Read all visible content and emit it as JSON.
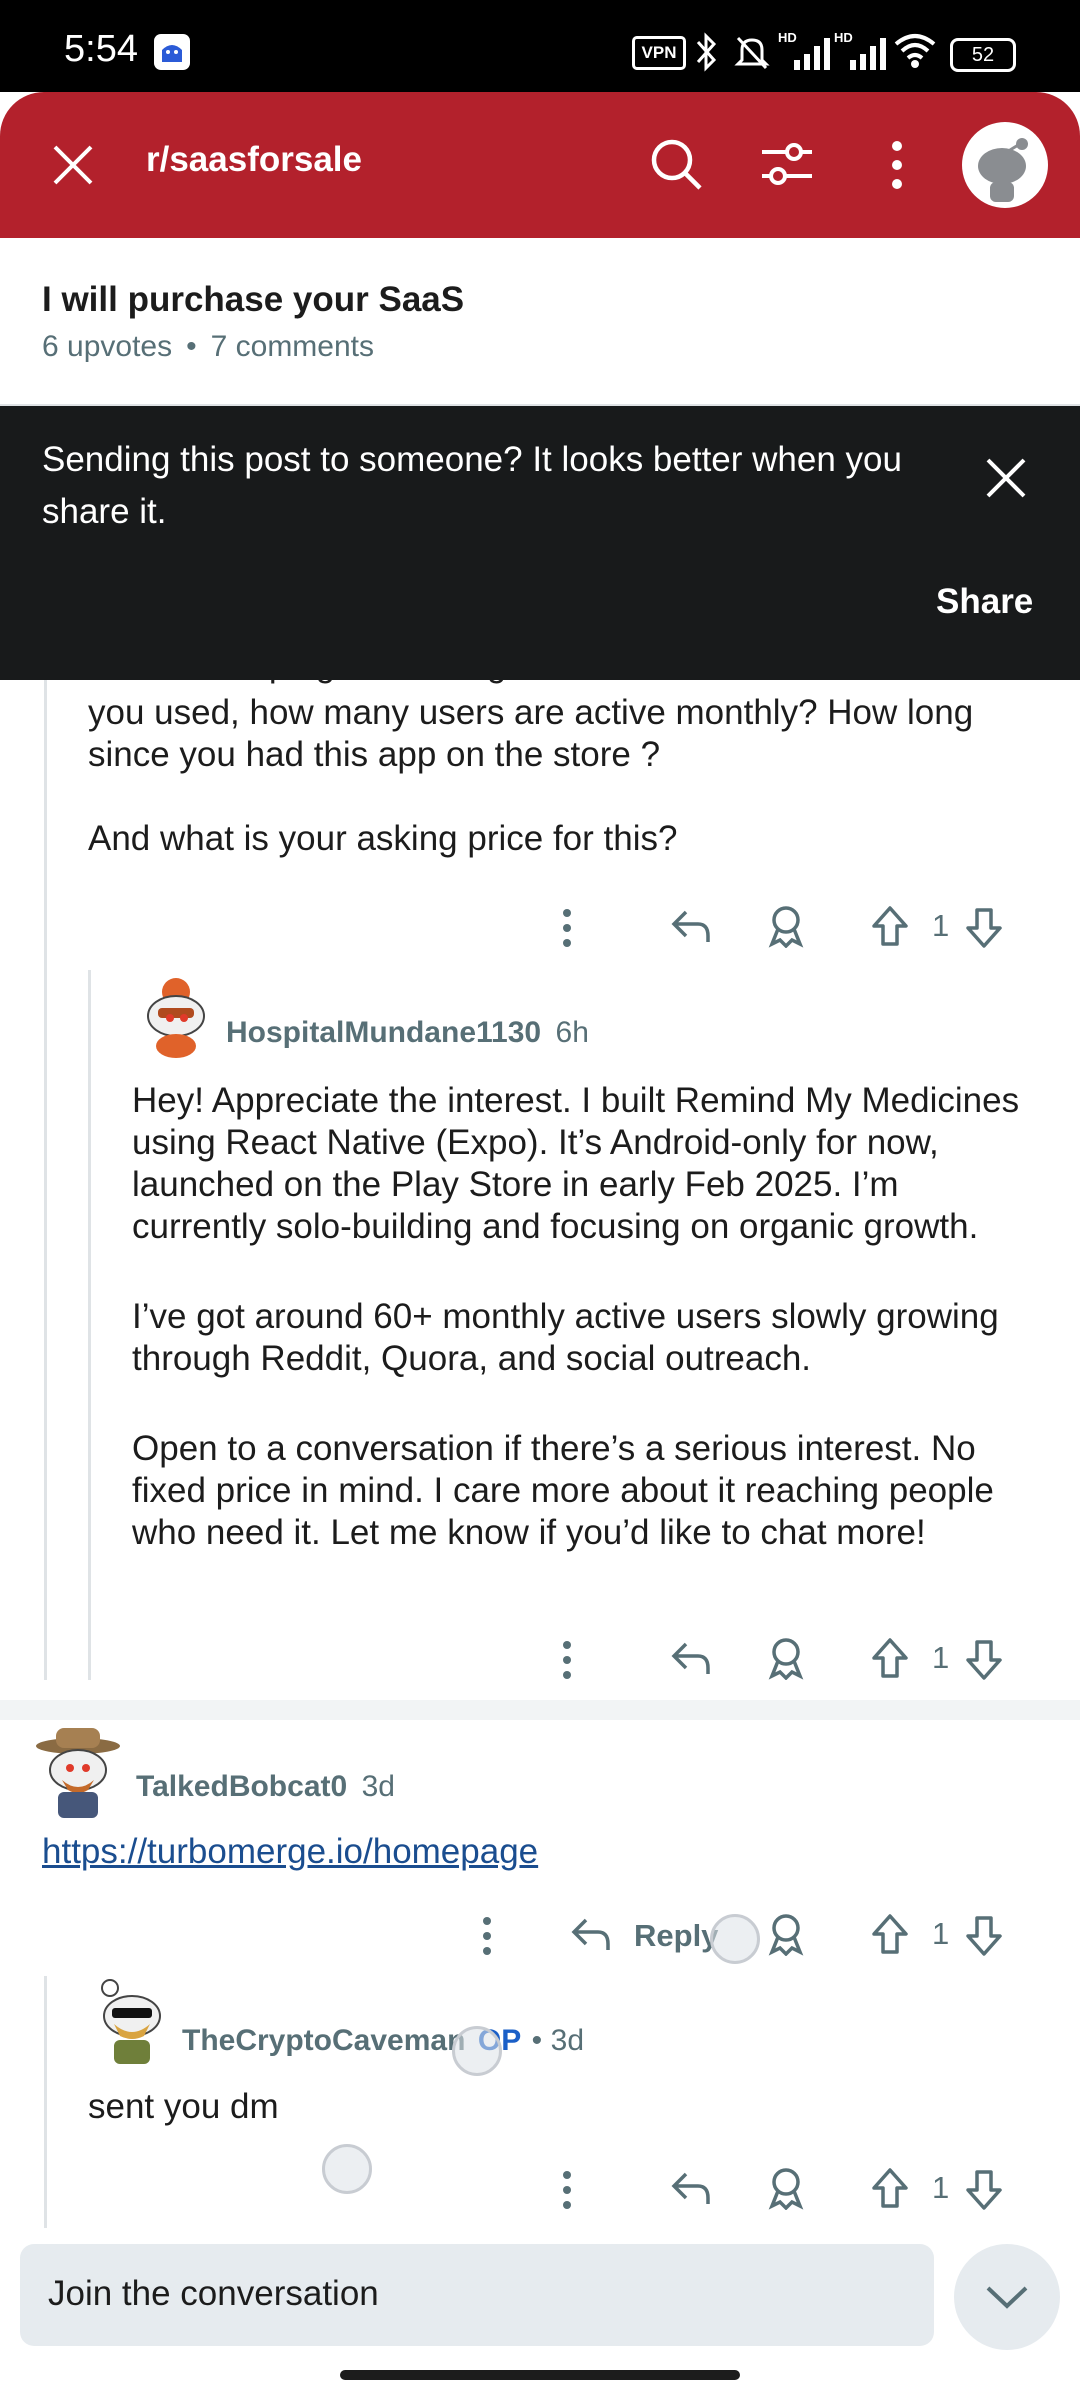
{
  "status_bar": {
    "time": "5:54",
    "vpn": "VPN",
    "net1": "HD",
    "net2": "HD",
    "battery": "52"
  },
  "header": {
    "subreddit": "r/saasforsale",
    "icons": [
      "close-icon",
      "search-icon",
      "filter-icon",
      "more-vertical-icon",
      "user-avatar"
    ]
  },
  "post": {
    "title": "I will purchase your SaaS",
    "upvotes": "6 upvotes",
    "separator": "•",
    "comments": "7 comments"
  },
  "toast": {
    "message": "Sending this post to someone? It looks better when you share it.",
    "share_label": "Share"
  },
  "comments": [
    {
      "body_lines": [
        "you used, how many users are active monthly? How long",
        "since you had this app on the store ?",
        "",
        "And what is your asking price for this?"
      ],
      "votes": "1"
    },
    {
      "username": "HospitalMundane1130",
      "age": "6h",
      "paragraphs": [
        "Hey! Appreciate the interest. I built Remind My Medicines using React Native (Expo). It’s Android-only for now, launched on the Play Store in early Feb 2025. I’m currently solo-building and focusing on organic growth.",
        "I’ve got around 60+ monthly active users slowly growing through Reddit, Quora, and social outreach.",
        "Open to a conversation if there’s a serious interest. No fixed price in mind. I care more about it reaching people who need it. Let me know if you’d like to chat more!"
      ],
      "votes": "1"
    },
    {
      "username": "TalkedBobcat0",
      "age": "3d",
      "link": "https://turbomerge.io/homepage",
      "reply_label": "Reply",
      "votes": "1"
    },
    {
      "username": "TheCryptoCaveman",
      "op_badge": "OP",
      "separator": "•",
      "age": "3d",
      "body": "sent you dm",
      "votes": "1"
    }
  ],
  "footer": {
    "placeholder": "Join the conversation"
  },
  "colors": {
    "header_bg": "#b3212c",
    "toast_bg": "#181a1b",
    "meta_text": "#576f76",
    "link": "#1a4d8f",
    "op_badge": "#1a5fc7"
  }
}
